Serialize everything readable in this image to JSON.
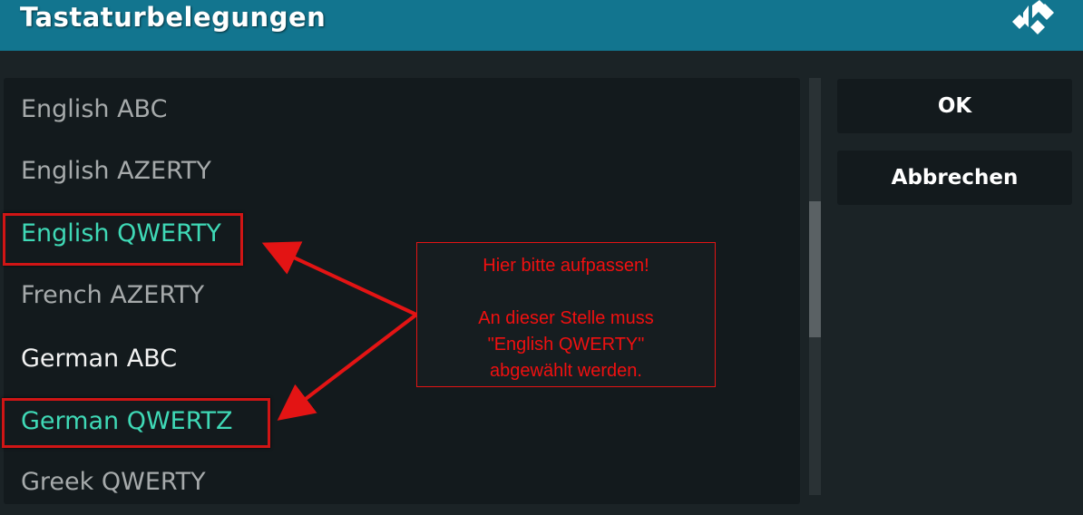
{
  "header": {
    "title": "Tastaturbelegungen"
  },
  "layouts": [
    {
      "label": "English ABC",
      "state": "normal"
    },
    {
      "label": "English AZERTY",
      "state": "normal"
    },
    {
      "label": "English QWERTY",
      "state": "selected"
    },
    {
      "label": "French AZERTY",
      "state": "normal"
    },
    {
      "label": "German ABC",
      "state": "focused"
    },
    {
      "label": "German QWERTZ",
      "state": "selected"
    },
    {
      "label": "Greek QWERTY",
      "state": "normal"
    }
  ],
  "buttons": {
    "ok": "OK",
    "cancel": "Abbrechen"
  },
  "annotation": {
    "line1": "Hier bitte aufpassen!",
    "line2": "",
    "line3": "An dieser Stelle muss",
    "line4": "\"English QWERTY\"",
    "line5": "abgewählt werden."
  },
  "colors": {
    "header": "#12758f",
    "selected_text": "#3fd9b6",
    "annotation_red": "#e31414",
    "background": "#1b2326"
  },
  "icons": {
    "logo": "kodi-logo-icon"
  }
}
